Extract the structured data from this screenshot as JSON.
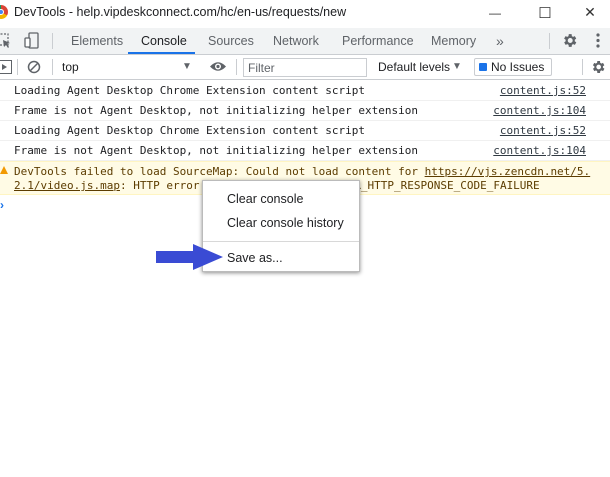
{
  "window": {
    "title": "DevTools - help.vipdeskconnect.com/hc/en-us/requests/new",
    "minimize_glyph": "—",
    "maximize_glyph": "☐",
    "close_glyph": "✕"
  },
  "tabs": [
    {
      "label": "Elements"
    },
    {
      "label": "Console"
    },
    {
      "label": "Sources"
    },
    {
      "label": "Network"
    },
    {
      "label": "Performance"
    },
    {
      "label": "Memory"
    }
  ],
  "active_tab": "Console",
  "more_tabs_glyph": "»",
  "toolbar": {
    "context": "top",
    "filter_placeholder": "Filter",
    "levels_label": "Default levels",
    "issues_label": "No Issues"
  },
  "messages": [
    {
      "text": "Loading Agent Desktop Chrome Extension content script",
      "source": "content.js:52"
    },
    {
      "text": "Frame is not Agent Desktop, not initializing helper extension",
      "source": "content.js:104"
    },
    {
      "text": "Loading Agent Desktop Chrome Extension content script",
      "source": "content.js:52"
    },
    {
      "text": "Frame is not Agent Desktop, not initializing helper extension",
      "source": "content.js:104"
    }
  ],
  "warning": {
    "line1_text": "DevTools failed to load SourceMap: Could not load content for ",
    "line1_link": "https://vjs.zencdn.net/5.",
    "line2_link": "2.1/video.js.map",
    "line2_text": ": HTTP error",
    "line2_tail": "ERR_HTTP_RESPONSE_CODE_FAILURE"
  },
  "context_menu": {
    "items": [
      {
        "label": "Clear console"
      },
      {
        "label": "Clear console history"
      },
      {
        "label": "Save as..."
      }
    ]
  },
  "colors": {
    "accent": "#1a73e8",
    "warning_bg": "#fffbe5",
    "annotation_arrow": "#3a4bd4"
  }
}
